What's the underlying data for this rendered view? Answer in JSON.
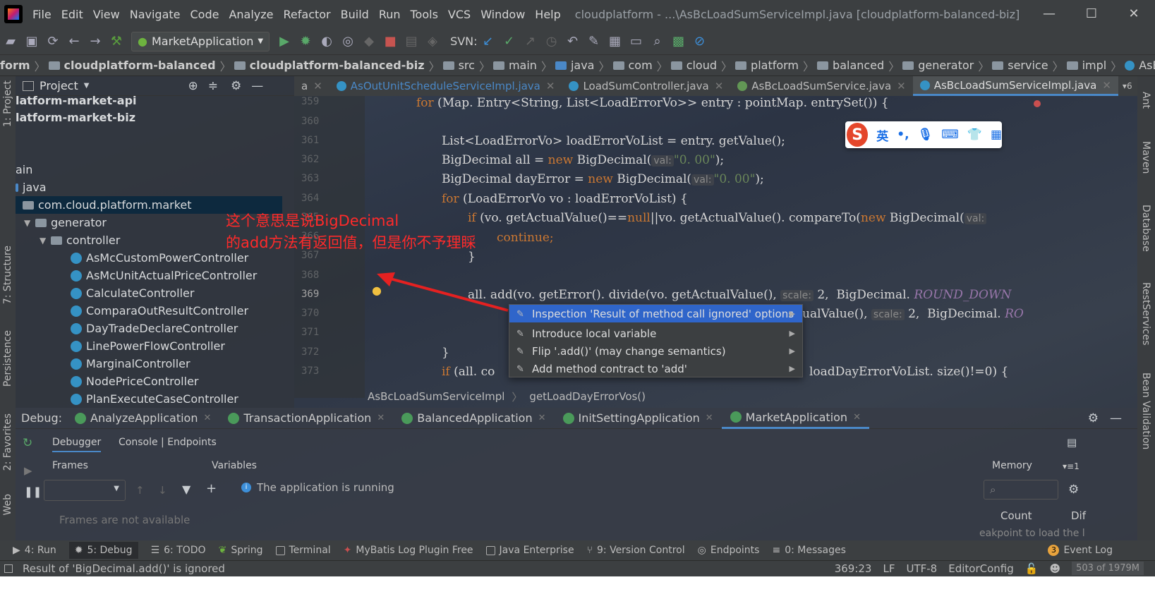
{
  "menu": {
    "items": [
      "File",
      "Edit",
      "View",
      "Navigate",
      "Code",
      "Analyze",
      "Refactor",
      "Build",
      "Run",
      "Tools",
      "VCS",
      "Window",
      "Help"
    ],
    "title": "cloudplatform - ...\\AsBcLoadSumServiceImpl.java [cloudplatform-balanced-biz]"
  },
  "toolbar": {
    "run_config": "MarketApplication",
    "svn_label": "SVN:"
  },
  "breadcrumb": [
    "form",
    "cloudplatform-balanced",
    "cloudplatform-balanced-biz",
    "src",
    "main",
    "java",
    "com",
    "cloud",
    "platform",
    "balanced",
    "generator",
    "service",
    "impl",
    "AsBcLoadSumServiceImpl"
  ],
  "left_stripe": [
    "1: Project",
    "7: Structure",
    "Persistence",
    "2: Favorites",
    "Web"
  ],
  "right_stripe": [
    "Ant",
    "Maven",
    "Database",
    "RestServices",
    "Bean Validation"
  ],
  "project": {
    "header": "Project",
    "tree": [
      "latform-market-api",
      "latform-market-biz",
      "ain",
      "java",
      "com.cloud.platform.market",
      "generator",
      "controller",
      "AsMcCustomPowerController",
      "AsMcUnitActualPriceController",
      "CalculateController",
      "ComparaOutResultController",
      "DayTradeDeclareController",
      "LinePowerFlowController",
      "MarginalController",
      "NodePriceController",
      "PlanExecuteCaseController"
    ]
  },
  "editor": {
    "tabs": [
      "a",
      "AsOutUnitScheduleServiceImpl.java",
      "LoadSumController.java",
      "AsBcLoadSumService.java",
      "AsBcLoadSumServiceImpl.java"
    ],
    "tab_count": "6",
    "line_numbers": [
      "359",
      "360",
      "361",
      "362",
      "363",
      "364",
      "365",
      "366",
      "367",
      "368",
      "369",
      "370",
      "371",
      "372",
      "373"
    ],
    "code": {
      "l359a": "for",
      "l359b": " (Map. Entry<String, List<LoadErrorVo>> entry : pointMap. entrySet()) {",
      "l361": "List<LoadErrorVo> loadErrorVoList = entry. getValue();",
      "l362a": "BigDecimal all = ",
      "l362b": "new",
      "l362c": " BigDecimal(",
      "l362h": "val:",
      "l362s": "\"0. 00\"",
      "l362e": ");",
      "l363a": "BigDecimal dayError = ",
      "l363b": "new",
      "l363c": " BigDecimal(",
      "l363h": "val:",
      "l363s": "\"0. 00\"",
      "l363e": ");",
      "l364a": "for",
      "l364b": " (LoadErrorVo vo : loadErrorVoList) {",
      "l365a": "if",
      "l365b": " (vo. getActualValue()==",
      "l365c": "null",
      "l365d": "||vo. getActualValue(). compareTo(",
      "l365e": "new",
      "l365f": " BigDecimal(",
      "l365h": "val:",
      "l366": "continue;",
      "l367": "}",
      "l369a": "all. add(vo. getError(). divide(vo. getActualValue(), ",
      "l369h": "scale:",
      "l369b": " 2,  BigDecimal. ",
      "l369c": "ROUND_DOWN",
      "l370a": "ualValue(), ",
      "l370h": "scale:",
      "l370b": " 2,  BigDecimal. ",
      "l370c": "RO",
      "l372": "}",
      "l373a": "if",
      "l373b": " (all. co",
      "l373c": "loadDayErrorVoList. size()!=0) {"
    },
    "crumb": [
      "AsBcLoadSumServiceImpl",
      "getLoadDayErrorVos()"
    ]
  },
  "popup": [
    "Inspection 'Result of method call ignored' options",
    "Introduce local variable",
    "Flip '.add()' (may change semantics)",
    "Add method contract to 'add'"
  ],
  "annotation": [
    "这个意思是说BigDecimal",
    "的add方法有返回值，但是你不予理睬"
  ],
  "ime": {
    "logo": "S",
    "lang": "英"
  },
  "debug": {
    "label": "Debug:",
    "tabs": [
      "AnalyzeApplication",
      "TransactionApplication",
      "BalancedApplication",
      "InitSettingApplication",
      "MarketApplication"
    ],
    "subtabs": [
      "Debugger",
      "Console | Endpoints"
    ],
    "frames_title": "Frames",
    "variables_title": "Variables",
    "memory_title": "Memory",
    "frames_empty": "Frames are not available",
    "running": "The application is running",
    "count": "Count",
    "diff": "Dif",
    "breakpoint": "eakpoint to load the l",
    "memory_suffix": "1"
  },
  "bottom_tabs": [
    "4: Run",
    "5: Debug",
    "6: TODO",
    "Spring",
    "Terminal",
    "MyBatis Log Plugin Free",
    "Java Enterprise",
    "9: Version Control",
    "Endpoints",
    "0: Messages",
    "Event Log"
  ],
  "event_count": "3",
  "status": {
    "message": "Result of 'BigDecimal.add()' is ignored",
    "position": "369:23",
    "line_sep": "LF",
    "encoding": "UTF-8",
    "editor_config": "EditorConfig",
    "memory": "503 of 1979M"
  }
}
